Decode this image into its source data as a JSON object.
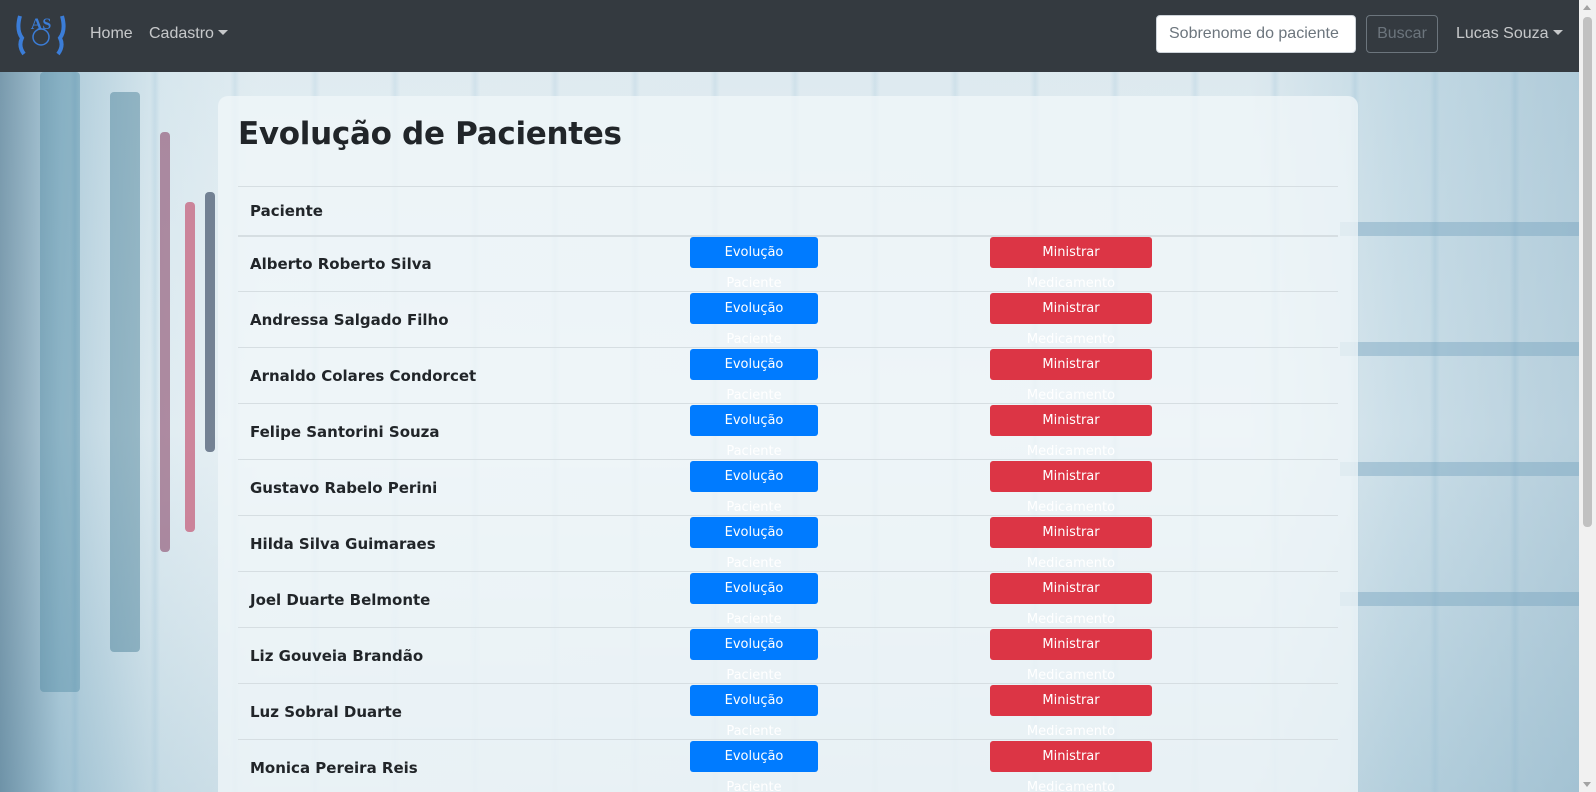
{
  "navbar": {
    "logo_text": "AS",
    "home_label": "Home",
    "cadastro_label": "Cadastro",
    "search_placeholder": "Sobrenome do paciente",
    "search_button": "Buscar",
    "user_name": "Lucas Souza"
  },
  "main": {
    "title": "Evolução de Pacientes",
    "table": {
      "header": "Paciente",
      "rows": [
        {
          "name": "Alberto Roberto Silva",
          "evo": "Evolução Paciente",
          "med": "Ministrar Medicamento"
        },
        {
          "name": "Andressa Salgado Filho",
          "evo": "Evolução Paciente",
          "med": "Ministrar Medicamento"
        },
        {
          "name": "Arnaldo Colares Condorcet",
          "evo": "Evolução Paciente",
          "med": "Ministrar Medicamento"
        },
        {
          "name": "Felipe Santorini Souza",
          "evo": "Evolução Paciente",
          "med": "Ministrar Medicamento"
        },
        {
          "name": "Gustavo Rabelo Perini",
          "evo": "Evolução Paciente",
          "med": "Ministrar Medicamento"
        },
        {
          "name": "Hilda Silva Guimaraes",
          "evo": "Evolução Paciente",
          "med": "Ministrar Medicamento"
        },
        {
          "name": "Joel Duarte Belmonte",
          "evo": "Evolução Paciente",
          "med": "Ministrar Medicamento"
        },
        {
          "name": "Liz Gouveia Brandão",
          "evo": "Evolução Paciente",
          "med": "Ministrar Medicamento"
        },
        {
          "name": "Luz Sobral Duarte",
          "evo": "Evolução Paciente",
          "med": "Ministrar Medicamento"
        },
        {
          "name": "Monica Pereira Reis",
          "evo": "Evolução Paciente",
          "med": "Ministrar Medicamento"
        }
      ]
    }
  },
  "colors": {
    "navbar_bg": "#343a40",
    "primary": "#007bff",
    "danger": "#dc3545"
  }
}
